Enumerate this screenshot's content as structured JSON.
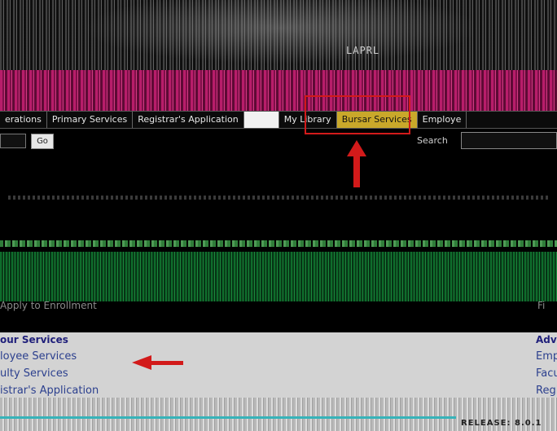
{
  "banner": {
    "mark": "LAPRL"
  },
  "menu": {
    "items": [
      "erations",
      "Primary Services",
      "Registrar's Application",
      "",
      "My Library",
      "Bursar Services",
      "Employe"
    ]
  },
  "search": {
    "go_label": "Go",
    "label": "Search"
  },
  "main": {
    "enrollment_link": "Apply to Enrollment",
    "right_fragment": "Fi"
  },
  "services": {
    "heading": "our Services",
    "items": [
      "loyee Services",
      "ulty Services",
      "istrar's Application"
    ],
    "right_heading": "Adv",
    "right_items": [
      "Emp",
      "Facu",
      "Regi"
    ]
  },
  "footer": {
    "release": "RELEASE: 8.0.1"
  },
  "colors": {
    "magenta": "#b81d6a",
    "annotation_red": "#d21a1a",
    "link_blue": "#2b3f8e",
    "panel_green": "#0e6d2c"
  }
}
